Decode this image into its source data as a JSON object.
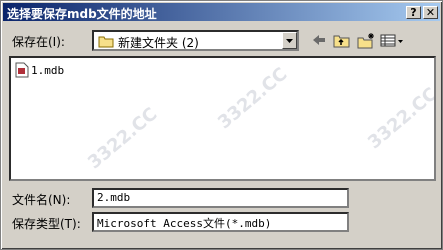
{
  "window": {
    "title": "选择要保存mdb文件的地址",
    "help_label": "?",
    "close_label": "✕"
  },
  "location": {
    "label": "保存在(I):",
    "value": "新建文件夹 (2)"
  },
  "toolbar": {
    "icons": [
      "back-icon",
      "up-folder-icon",
      "new-folder-icon",
      "view-menu-icon"
    ]
  },
  "files": [
    {
      "name": "1.mdb"
    }
  ],
  "filename": {
    "label": "文件名(N):",
    "value": "2.mdb"
  },
  "filetype": {
    "label": "保存类型(T):",
    "value": "Microsoft Access文件(*.mdb)"
  },
  "watermark": "3322.CC"
}
